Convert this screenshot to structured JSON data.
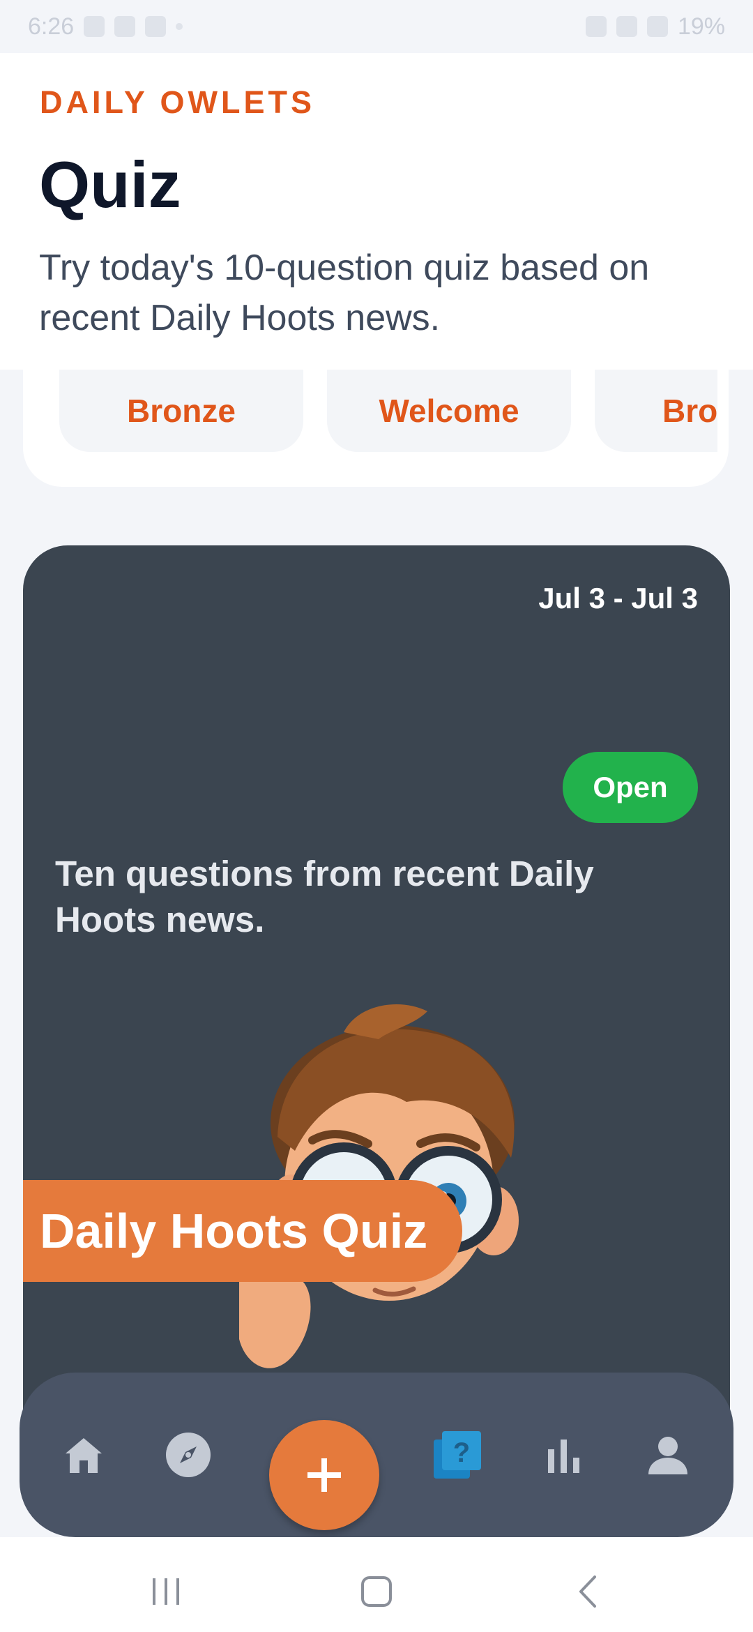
{
  "status_bar": {
    "time": "6:26",
    "battery": "19%"
  },
  "header": {
    "brand": "DAILY OWLETS",
    "title": "Quiz",
    "subtitle": "Try today's 10-question quiz based on recent Daily Hoots news."
  },
  "badges": [
    {
      "label": "Bronze"
    },
    {
      "label": "Welcome"
    },
    {
      "label": "Bronze"
    }
  ],
  "quiz_card": {
    "date_range": "Jul 3 - Jul 3",
    "title": "Daily Hoots Quiz",
    "status": "Open",
    "description": "Ten questions from recent Daily Hoots news.",
    "status_color": "#22b24c",
    "accent_color": "#e57a3c"
  },
  "bottom_nav": {
    "items": [
      {
        "icon": "home-icon"
      },
      {
        "icon": "compass-icon"
      },
      {
        "icon": "add-icon"
      },
      {
        "icon": "quiz-icon",
        "active": true
      },
      {
        "icon": "bar-chart-icon"
      },
      {
        "icon": "profile-icon"
      }
    ]
  },
  "colors": {
    "brand": "#e0561a",
    "card_bg": "#3b4550",
    "nav_bg": "#4a5466",
    "active_nav": "#1b84c4"
  }
}
